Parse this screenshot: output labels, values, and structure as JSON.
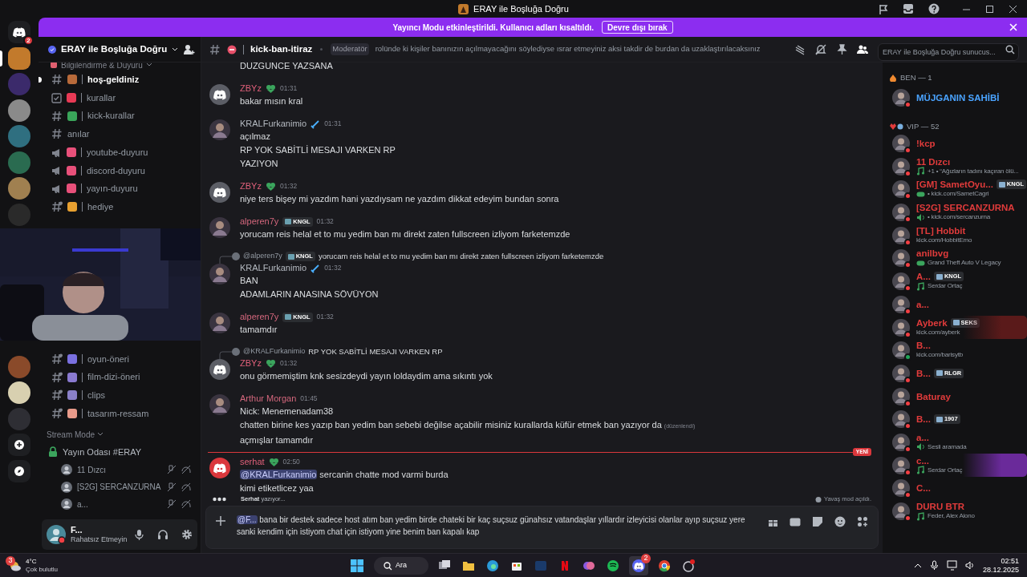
{
  "window": {
    "title": "ERAY ile Boşluğa Doğru"
  },
  "banner": {
    "text": "Yayıncı Modu etkinleştirildi. Kullanıcı adları kısaltıldı.",
    "button": "Devre dışı bırak"
  },
  "server_rail": {
    "dm_badge": "2",
    "servers": [
      {
        "selected": true,
        "color": "#c27a2c"
      },
      {
        "selected": false,
        "color": "#3b2a6b"
      },
      {
        "selected": false,
        "color": "#8a8a8a"
      },
      {
        "selected": false,
        "color": "#2f6f80"
      },
      {
        "selected": false,
        "color": "#2a6b50"
      },
      {
        "selected": false,
        "color": "#a08050"
      },
      {
        "selected": false,
        "color": "#2a2a2a"
      }
    ],
    "servers_lower": [
      {
        "selected": false,
        "color": "#8a4a2a"
      },
      {
        "selected": false,
        "color": "#d8d0b0"
      },
      {
        "selected": false,
        "color": "#2e2e34"
      }
    ]
  },
  "sidebar": {
    "server_name": "ERAY ile Boşluğa Doğru",
    "category": "Bilgilendirme & Duyuru",
    "channels": [
      {
        "kind": "text",
        "name": "hoş-geldiniz",
        "color": "#b86a3a",
        "unread": true
      },
      {
        "kind": "rules",
        "name": "kurallar",
        "color": "#e83a55",
        "unread": false
      },
      {
        "kind": "text",
        "name": "kick-kurallar",
        "color": "#3aa55a",
        "unread": false
      },
      {
        "kind": "text",
        "name": "anılar",
        "unread": false
      },
      {
        "kind": "announcement",
        "name": "youtube-duyuru",
        "color": "#e8507a",
        "unread": false
      },
      {
        "kind": "announcement",
        "name": "discord-duyuru",
        "color": "#e8507a",
        "unread": false
      },
      {
        "kind": "announcement",
        "name": "yayın-duyuru",
        "color": "#e8507a",
        "unread": false
      },
      {
        "kind": "thread",
        "name": "hediye",
        "color": "#e8a030",
        "unread": false
      }
    ],
    "channels_lower": [
      {
        "kind": "thread",
        "name": "oyun-öneri",
        "color": "#7a70e0",
        "unread": false
      },
      {
        "kind": "thread",
        "name": "film-dizi-öneri",
        "color": "#8a7ad0",
        "unread": false
      },
      {
        "kind": "thread",
        "name": "clips",
        "color": "#8a80c8",
        "unread": false
      },
      {
        "kind": "thread",
        "name": "tasarım-ressam",
        "color": "#e89a8a",
        "unread": false
      }
    ],
    "voice_category": "Stream Mode",
    "voice_channel": {
      "name": "Yayın Odası #ERAY",
      "users": [
        {
          "name": "11 Dızcı"
        },
        {
          "name": "[S2G] SERCANZURNA"
        },
        {
          "name": "a..."
        }
      ]
    },
    "user_panel": {
      "name": "F...",
      "status": "Rahatsız Etmeyin"
    }
  },
  "channel_header": {
    "name": "kick-ban-itiraz",
    "topic_mention": "Moderatör",
    "topic": "rolünde ki kişiler banınızın açılmayacağını söylediyse ısrar etmeyiniz aksi takdir de burdan da uzaklaştırılacaksınız",
    "search_placeholder": "ERAY ile Boşluğa Doğru sunucus..."
  },
  "messages": [
    {
      "kind": "continued",
      "lines": [
        "DUZGUNCE YAZSANA"
      ]
    },
    {
      "kind": "group",
      "author": "ZBYz",
      "color": "#e0607a",
      "avatar": {
        "kind": "default"
      },
      "role_icon": {
        "kind": "leaf"
      },
      "time": "01:31",
      "lines": [
        "bakar mısın kral"
      ]
    },
    {
      "kind": "group",
      "author": "KRALFurkanimio",
      "color": "#b5bac1",
      "avatar": {
        "kind": "picture"
      },
      "role_icon": {
        "kind": "sword"
      },
      "time": "01:31",
      "lines": [
        "açılmaz",
        "RP YOK SABİTLİ MESAJI VARKEN RP",
        "YAZIYON"
      ]
    },
    {
      "kind": "group",
      "author": "ZBYz",
      "color": "#e0607a",
      "avatar": {
        "kind": "default"
      },
      "role_icon": {
        "kind": "leaf"
      },
      "time": "01:32",
      "lines": [
        "niye ters bişey mi yazdım hani yazdıysam ne yazdım dikkat edeyim bundan sonra"
      ]
    },
    {
      "kind": "group",
      "author": "alperen7y",
      "color": "#d4677d",
      "avatar": {
        "kind": "picture"
      },
      "tag": "KNGL",
      "time": "01:32",
      "lines": [
        "yorucam reis helal et to mu yedim ban mı direkt zaten fullscreen izliyom farketemzde"
      ]
    },
    {
      "kind": "group",
      "author": "KRALFurkanimio",
      "color": "#b5bac1",
      "avatar": {
        "kind": "picture"
      },
      "role_icon": {
        "kind": "sword"
      },
      "time": "01:32",
      "reply": {
        "author": "@alperen7y",
        "tag": "KNGL",
        "text": "yorucam reis helal et to mu yedim ban mı direkt zaten fullscreen izliyom farketemzde"
      },
      "lines": [
        "BAN",
        "ADAMLARIN ANASINA SÖVÜYON"
      ]
    },
    {
      "kind": "group",
      "author": "alperen7y",
      "color": "#d4677d",
      "avatar": {
        "kind": "picture"
      },
      "tag": "KNGL",
      "time": "01:32",
      "lines": [
        "tamamdır"
      ]
    },
    {
      "kind": "group",
      "author": "ZBYz",
      "color": "#e0607a",
      "avatar": {
        "kind": "default"
      },
      "role_icon": {
        "kind": "leaf"
      },
      "time": "01:32",
      "reply": {
        "author": "@KRALFurkanimio",
        "text": "RP YOK SABİTLİ MESAJI VARKEN RP"
      },
      "lines": [
        "onu görmemiştim knk sesizdeydi yayın loldaydim ama sıkıntı yok"
      ]
    },
    {
      "kind": "group",
      "author": "Arthur Morgan",
      "color": "#d4677d",
      "avatar": {
        "kind": "picture"
      },
      "time": "01:45",
      "lines": [
        "Nick: Menemenadam38",
        "chatten birine kes yazıp ban yedim ban sebebi değilse açabilir misiniz kurallarda küfür etmek ban yazıyor da"
      ],
      "edited": "(düzenlendi)",
      "extra_lines": [
        "açmışlar tamamdır"
      ]
    },
    {
      "kind": "divider",
      "label": "YENİ"
    },
    {
      "kind": "group",
      "author": "serhat",
      "color": "#e0607a",
      "avatar": {
        "kind": "default-red"
      },
      "role_icon": {
        "kind": "leaf"
      },
      "time": "02:50",
      "mention": "@KRALFurkanimio",
      "lines": [
        "sercanin chatte mod varmi burda",
        "kimi etiketlicez yaa"
      ]
    }
  ],
  "typing": {
    "user": "Serhat",
    "text": "yazıyor...",
    "slowmode": "Yavaş mod açıldı."
  },
  "composer": {
    "mention": "@F...",
    "value": "bana bir destek sadece host atım ban yedim birde chateki bir kaç suçsuz günahsız vatandaşlar yıllardır izleyicisi olanlar ayıp suçsuz yere sanki kendim için istiyom chat için istiyom yine benim ban kapalı kap"
  },
  "members": [
    {
      "heading": "BEN — 1",
      "items": [
        {
          "name": "MÜJGANIN SAHİBİ",
          "color": "#4aa3ff",
          "online": false
        }
      ]
    },
    {
      "heading": "VIP — 52",
      "items": [
        {
          "name": "!kcp",
          "color": "#e03b3b",
          "online": false
        },
        {
          "name": "11 Dızcı",
          "color": "#e03b3b",
          "online": false,
          "activity": {
            "kind": "music",
            "text": "+1 • “Ağızların tadını kaçıran ölü..."
          }
        },
        {
          "name": "[GM] SametOyu...",
          "color": "#e03b3b",
          "online": false,
          "badge": "KNGL",
          "activity": {
            "kind": "game",
            "text": "• kick.com/SametCagri"
          }
        },
        {
          "name": "[S2G] SERCANZURNA",
          "color": "#e03b3b",
          "online": false,
          "activity": {
            "kind": "voice",
            "text": "• kick.com/sercanzurna"
          }
        },
        {
          "name": "[TL] Hobbit",
          "color": "#e03b3b",
          "online": false,
          "activity": {
            "kind": "plain",
            "text": "kick.com/HobbitEmo"
          }
        },
        {
          "name": "anilbvg",
          "color": "#e03b3b",
          "online": false,
          "activity": {
            "kind": "game",
            "text": "Grand Theft Auto V Legacy"
          }
        },
        {
          "name": "A...",
          "color": "#e03b3b",
          "online": false,
          "badge": "KNGL",
          "activity": {
            "kind": "music",
            "text": "Serdar Ortaç"
          }
        },
        {
          "name": "a...",
          "color": "#e03b3b",
          "online": false
        },
        {
          "name": "Ayberk",
          "color": "#e03b3b",
          "online": false,
          "badge": "SEKS",
          "banner": {
            "color": "#5a1a1a"
          },
          "activity": {
            "kind": "plain",
            "text": "kick.com/ayberk"
          }
        },
        {
          "name": "B...",
          "color": "#e03b3b",
          "online": true,
          "activity": {
            "kind": "plain",
            "text": "kick.com/barisytb"
          }
        },
        {
          "name": "B...",
          "color": "#e03b3b",
          "online": false,
          "badge": "RLGR"
        },
        {
          "name": "Baturay",
          "color": "#e03b3b",
          "online": false
        },
        {
          "name": "B...",
          "color": "#e03b3b",
          "online": false,
          "badge": "1907"
        },
        {
          "name": "a...",
          "color": "#e03b3b",
          "online": false,
          "activity": {
            "kind": "voice",
            "text": "Sesli aramada"
          }
        },
        {
          "name": "c...",
          "color": "#e03b3b",
          "online": false,
          "banner": {
            "color": "#6a2a9a"
          },
          "activity": {
            "kind": "music",
            "text": "Serdar Ortaç"
          }
        },
        {
          "name": "C...",
          "color": "#e03b3b",
          "online": false
        },
        {
          "name": "DURU BTR",
          "color": "#e03b3b",
          "online": false,
          "activity": {
            "kind": "music",
            "text": "Feder, Alex Aiono"
          }
        }
      ]
    }
  ],
  "taskbar": {
    "weather_badge": "3",
    "temperature": "4°C",
    "weather": "Çok bulutlu",
    "search": "Ara",
    "discord_badge": "2",
    "time": "02:51",
    "date": "28.12.2025"
  }
}
